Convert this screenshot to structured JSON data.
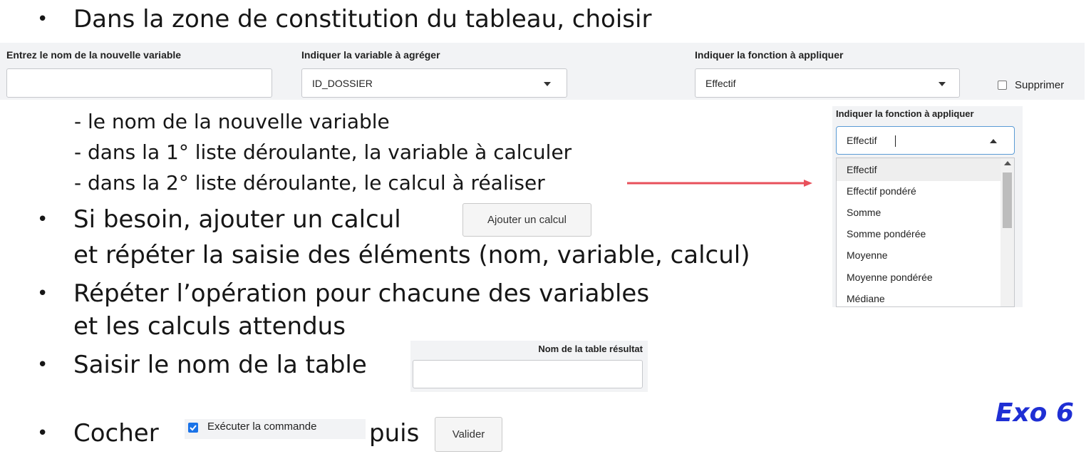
{
  "slide": {
    "line1": "Dans la zone de constitution du tableau, choisir",
    "sub1": "- le nom de la nouvelle variable",
    "sub2": "- dans la 1° liste déroulante, la variable à calculer",
    "sub3": "- dans la 2° liste déroulante, le calcul à réaliser",
    "line2a": "Si besoin, ajouter un calcul",
    "line2b": "et répéter la saisie des éléments (nom, variable, calcul)",
    "line3a": "Répéter l’opération pour chacune des variables",
    "line3b": "et les calculs attendus",
    "line4": "Saisir le nom de la table",
    "line5a": "Cocher",
    "line5b": "puis",
    "bullet": "•",
    "exo_label": "Exo 6"
  },
  "form": {
    "varname_label": "Entrez le nom de la nouvelle variable",
    "varname_value": "",
    "aggvar_label": "Indiquer la variable à agréger",
    "aggvar_value": "ID_DOSSIER",
    "func_label": "Indiquer la fonction à appliquer",
    "func_value": "Effectif",
    "delete_label": "Supprimer"
  },
  "dropdown": {
    "label": "Indiquer la fonction à appliquer",
    "value": "Effectif",
    "options": [
      "Effectif",
      "Effectif pondéré",
      "Somme",
      "Somme pondérée",
      "Moyenne",
      "Moyenne pondérée",
      "Médiane"
    ]
  },
  "buttons": {
    "add_calc": "Ajouter un calcul",
    "execute_label": "Exécuter la commande",
    "validate": "Valider"
  },
  "result_table": {
    "label": "Nom de la table résultat",
    "value": ""
  },
  "colors": {
    "accent": "#1f2fd4",
    "arrow": "#e8505b",
    "checkbox": "#1a73e8",
    "panel": "#f2f3f5"
  }
}
